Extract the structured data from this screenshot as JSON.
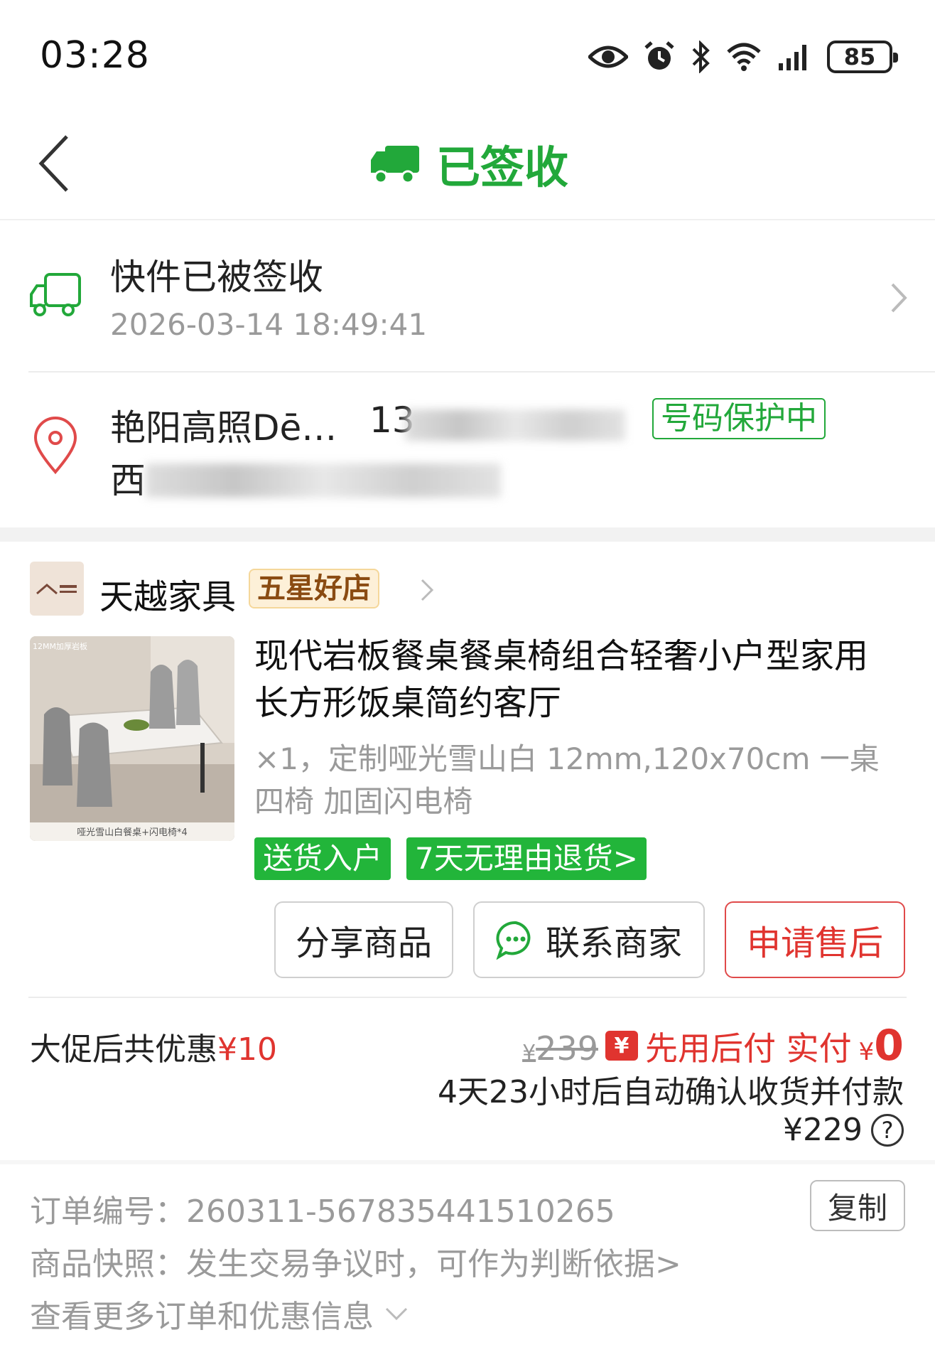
{
  "status_bar": {
    "time": "03:28",
    "battery": "85",
    "icons": [
      "eye-icon",
      "alarm-icon",
      "bluetooth-icon",
      "wifi-icon",
      "signal-icon",
      "battery-icon"
    ]
  },
  "header": {
    "title": "已签收",
    "accent_color": "#22a83a"
  },
  "logistics": {
    "title": "快件已被签收",
    "time": "2026-03-14 18:49:41"
  },
  "address": {
    "name": "艳阳高照Dē…",
    "phone": "13",
    "badge": "号码保护中",
    "line2": "西"
  },
  "shop": {
    "name": "天越家具",
    "badge": "五星好店"
  },
  "product": {
    "title": "现代岩板餐桌餐桌椅组合轻奢小户型家用长方形饭桌简约客厅",
    "spec": "×1，定制哑光雪山白 12mm,120x70cm 一桌四椅 加固闪电椅",
    "image_caption": "哑光雪山白餐桌+闪电椅*4",
    "image_corner": "12MM加厚岩板",
    "tags": [
      "送货入户",
      "7天无理由退货>"
    ]
  },
  "actions": {
    "share": "分享商品",
    "contact": "联系商家",
    "after_sale": "申请售后"
  },
  "price": {
    "promo_label": "大促后共优惠",
    "promo_value": "¥10",
    "original_symbol": "¥",
    "original": "239",
    "pay_badge": "¥",
    "pay_label": "先用后付 实付",
    "pay_symbol": "¥",
    "pay_amount": "0",
    "auto_confirm": "4天23小时后自动确认收货并付款",
    "total": "¥229",
    "help": "?"
  },
  "order": {
    "number_label": "订单编号：",
    "number": "260311-567835441510265",
    "copy": "复制",
    "snapshot": "商品快照：发生交易争议时，可作为判断依据>",
    "more": "查看更多订单和优惠信息"
  }
}
